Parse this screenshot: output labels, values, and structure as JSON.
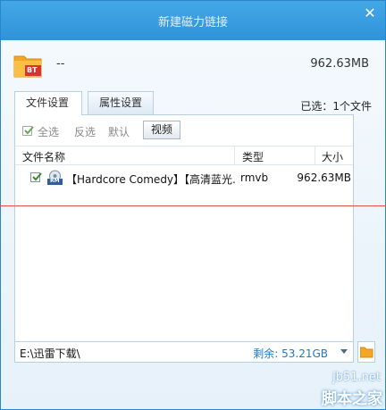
{
  "window": {
    "title": "新建磁力链接",
    "close_glyph": "✕"
  },
  "torrent": {
    "badge": "BT",
    "name": "--",
    "size": "962.63MB"
  },
  "tabs": [
    {
      "label": "文件设置",
      "active": true
    },
    {
      "label": "属性设置",
      "active": false
    }
  ],
  "selected_count": "已选：1个文件",
  "toolbar": {
    "select_all": "全选",
    "invert": "反选",
    "default": "默认",
    "video": "视频"
  },
  "columns": {
    "name": "文件名称",
    "type": "类型",
    "size": "大小"
  },
  "files": [
    {
      "checked": true,
      "icon_label": "RM",
      "name": "【Hardcore Comedy】【高清蓝光...",
      "type": "rmvb",
      "size": "962.63MB"
    }
  ],
  "path": {
    "value": "E:\\迅雷下载\\",
    "free_space": "剩余: 53.21GB"
  },
  "watermark": {
    "site": "jb51.net",
    "name": "脚本之家"
  },
  "colors": {
    "titlebar": "#3a9de2",
    "accent_blue": "#1f78c6",
    "folder_orange": "#f5a623",
    "badge_red": "#d9332c"
  }
}
